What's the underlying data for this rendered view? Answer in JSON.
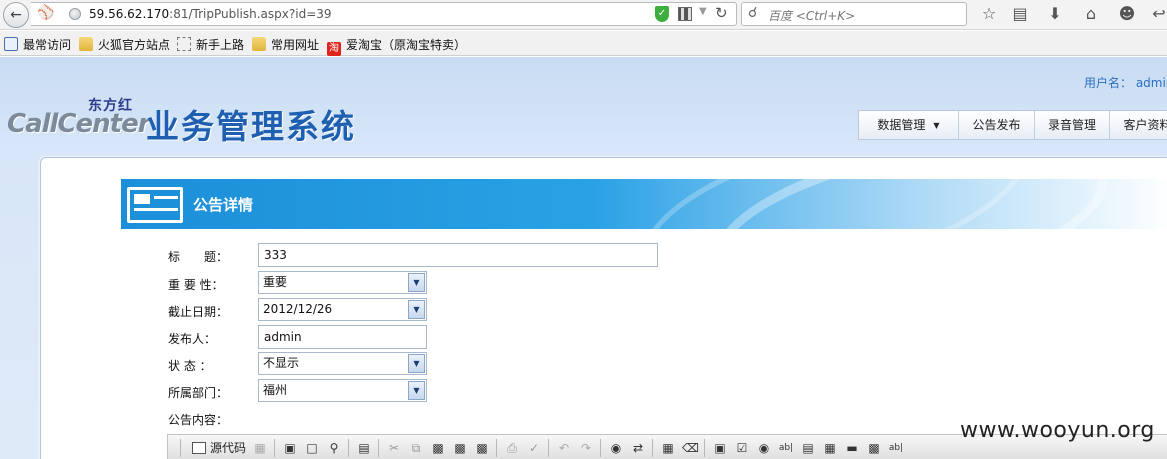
{
  "browser": {
    "url_host": "59.56.62.170",
    "url_rest": ":81/TripPublish.aspx?id=39",
    "search_placeholder": "百度 <Ctrl+K>",
    "bookmarks": [
      {
        "label": "最常访问",
        "icon": "search-icon"
      },
      {
        "label": "火狐官方站点",
        "icon": "folder-icon"
      },
      {
        "label": "新手上路",
        "icon": "page-icon"
      },
      {
        "label": "常用网址",
        "icon": "folder-icon"
      },
      {
        "label": "爱淘宝（原淘宝特卖）",
        "icon": "taobao-icon",
        "badge": "淘"
      }
    ]
  },
  "header": {
    "user_label": "用户名： admin",
    "logo_small": "东方红",
    "logo_brand": "CallCenter",
    "logo_title": "业务管理系统",
    "nav": [
      {
        "label": "数据管理",
        "has_dropdown": true
      },
      {
        "label": "公告发布"
      },
      {
        "label": "录音管理"
      },
      {
        "label": "客户资料"
      }
    ]
  },
  "form": {
    "section_title": "公告详情",
    "title_label": "标　　题：",
    "title_value": "333",
    "importance_label": "重 要 性：",
    "importance_value": "重要",
    "deadline_label": "截止日期：",
    "deadline_value": "2012/12/26",
    "publisher_label": "发布人：",
    "publisher_value": "admin",
    "status_label": "状 态 ：",
    "status_value": "不显示",
    "department_label": "所属部门：",
    "department_value": "福州",
    "content_label": "公告内容："
  },
  "editor": {
    "source_label": "源代码"
  },
  "watermark": "www.wooyun.org"
}
